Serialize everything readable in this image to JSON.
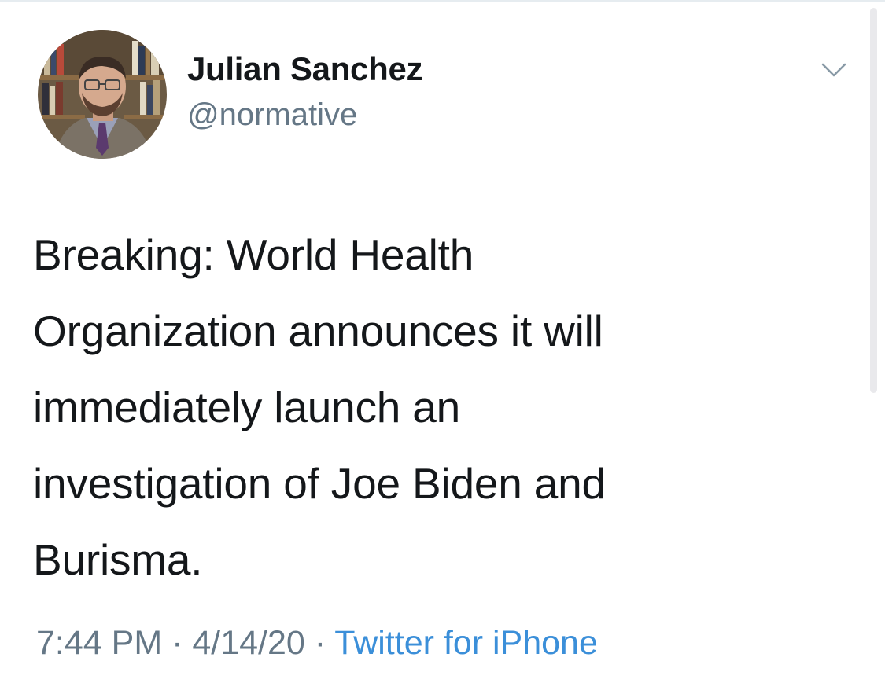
{
  "tweet": {
    "author": {
      "display_name": "Julian Sanchez",
      "handle": "@normative",
      "avatar": "profile-photo"
    },
    "text": "Breaking: World Health\nOrganization announces it will\nimmediately launch an\ninvestigation of Joe Biden and\nBurisma.",
    "time": "7:44 PM",
    "date": "4/14/20",
    "separator": "·",
    "source": "Twitter for iPhone",
    "menu_icon": "chevron-down-icon"
  },
  "colors": {
    "text": "#14171a",
    "secondary": "#657786",
    "link": "#3b8fd9"
  }
}
